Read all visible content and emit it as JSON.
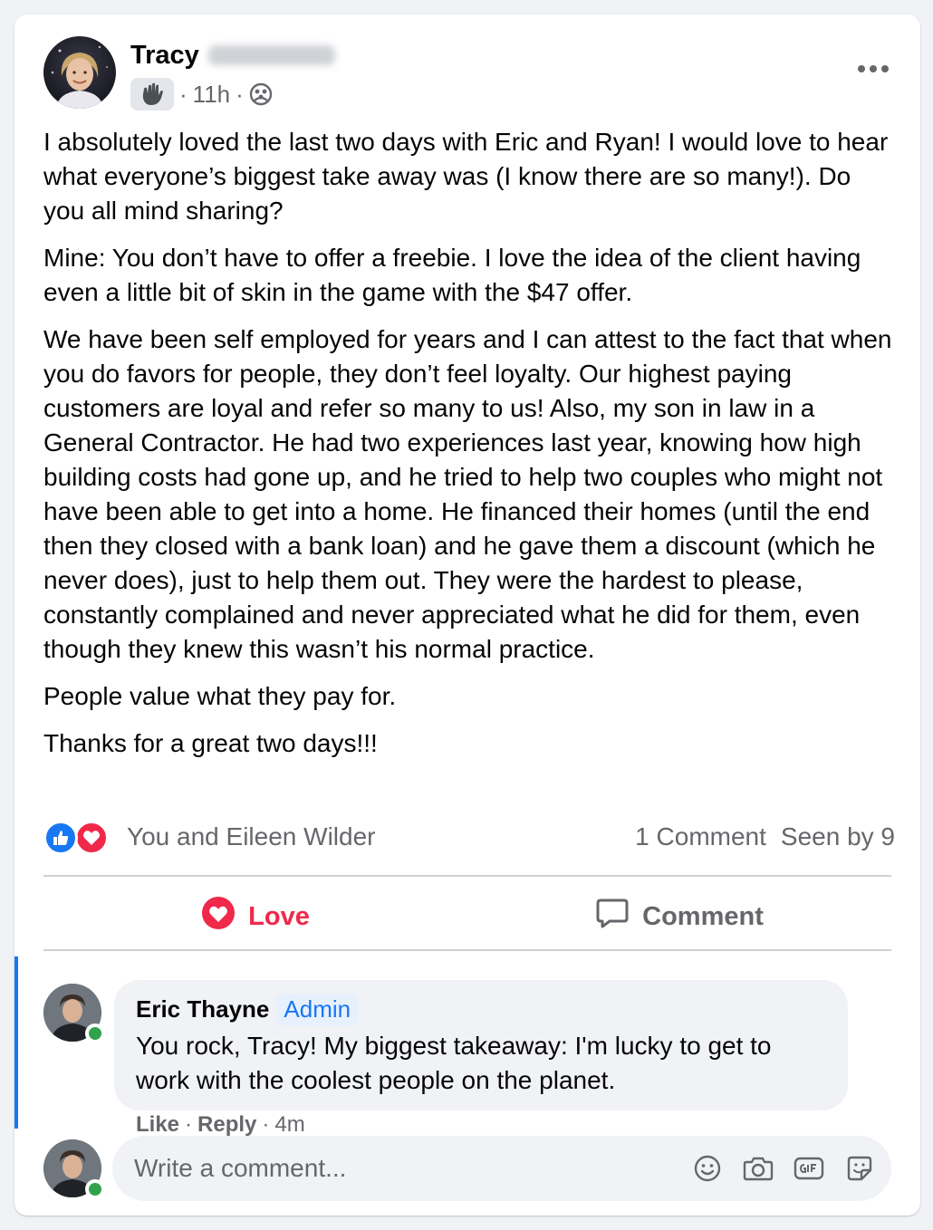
{
  "post": {
    "author_name": "Tracy",
    "time": "11h",
    "separator": "·",
    "paragraphs": [
      "I absolutely loved the last two days with Eric and Ryan!  I would love to hear what everyone’s biggest take away was (I know there are so many!).  Do you all mind sharing?",
      "Mine: You don’t have to offer a freebie.  I love the idea of the client having even a little bit of skin in the game with the $47 offer.",
      "We have been self employed for years and I can attest to the fact that when you do favors for people, they don’t feel loyalty.  Our highest paying customers are loyal and refer so many to us!  Also, my son in law in a General Contractor.  He had two experiences last year, knowing how high building costs had gone up, and he tried to help two couples who might not have been able to get into a home.  He financed their homes (until the end then they closed with a bank loan) and he gave them a discount (which he never does), just to help them out.  They were the hardest to please, constantly complained and never appreciated what he did for them, even though they knew this wasn’t his normal practice.",
      "People value what they pay for.",
      "Thanks for a great two days!!!"
    ]
  },
  "stats": {
    "reactors": "You and Eileen Wilder",
    "comments": "1 Comment",
    "seen_by": "Seen by 9"
  },
  "actions": {
    "love_label": "Love",
    "comment_label": "Comment"
  },
  "comment": {
    "author": "Eric Thayne",
    "badge": "Admin",
    "text": "You rock, Tracy! My biggest takeaway: I'm lucky to get to work with the coolest people on the planet.",
    "like_label": "Like",
    "reply_label": "Reply",
    "time": "4m",
    "separator": "·"
  },
  "composer": {
    "placeholder": "Write a comment..."
  },
  "colors": {
    "accent": "#1877f2",
    "love": "#f0284a",
    "secondary_text": "#65676b",
    "online": "#31a24c"
  },
  "icons": [
    "more-options-icon",
    "wave-badge-icon",
    "group-audience-icon",
    "like-reaction-icon",
    "love-reaction-icon",
    "heart-icon",
    "comment-bubble-icon",
    "emoji-icon",
    "camera-icon",
    "gif-icon",
    "sticker-icon"
  ]
}
